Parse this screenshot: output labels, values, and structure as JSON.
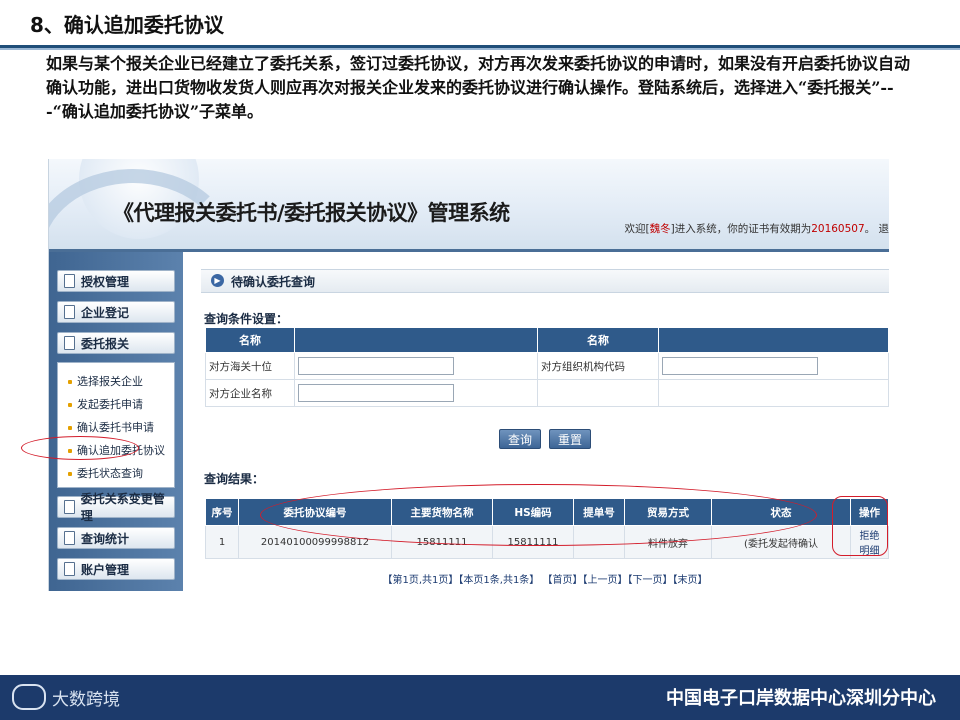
{
  "slide": {
    "title": "8、确认追加委托协议",
    "intro": "如果与某个报关企业已经建立了委托关系，签订过委托协议，对方再次发来委托协议的申请时，如果没有开启委托协议自动确认功能，进出口货物收发货人则应再次对报关企业发来的委托协议进行确认操作。登陆系统后，选择进入“委托报关”---“确认追加委托协议”子菜单。"
  },
  "app": {
    "system_title": "《代理报关委托书/委托报关协议》管理系统",
    "welcome_prefix": "欢迎[",
    "welcome_user": "魏冬",
    "welcome_mid": "]进入系统，你的证书有效期为",
    "welcome_date": "20160507",
    "welcome_suffix": "。 退"
  },
  "sidebar": {
    "items": [
      {
        "label": "授权管理"
      },
      {
        "label": "企业登记"
      },
      {
        "label": "委托报关"
      }
    ],
    "sub_items": [
      {
        "label": "选择报关企业"
      },
      {
        "label": "发起委托申请"
      },
      {
        "label": "确认委托书申请"
      },
      {
        "label": "确认追加委托协议"
      },
      {
        "label": "委托状态查询"
      }
    ],
    "lower_items": [
      {
        "label": "委托关系变更管理"
      },
      {
        "label": "查询统计"
      },
      {
        "label": "账户管理"
      }
    ]
  },
  "main": {
    "section_title": "待确认委托查询",
    "conditions_label": "查询条件设置：",
    "query_table": {
      "headers": [
        "名称",
        "",
        "名称",
        ""
      ],
      "rows": [
        {
          "label1": "对方海关十位",
          "label2": "对方组织机构代码"
        },
        {
          "label1": "对方企业名称",
          "label2": ""
        }
      ]
    },
    "buttons": {
      "query": "查询",
      "reset": "重置"
    },
    "results_label": "查询结果：",
    "results_table": {
      "headers": [
        "序号",
        "委托协议编号",
        "主要货物名称",
        "HS编码",
        "提单号",
        "贸易方式",
        "状态",
        "操作"
      ],
      "rows": [
        {
          "no": "1",
          "agreement_no": "20140100099998812",
          "goods": "15811111",
          "hs": "15811111",
          "bill": "",
          "trade": "料件放弃",
          "status": "(委托发起待确认",
          "op_reject": "拒绝",
          "op_confirm": "明细"
        }
      ]
    },
    "pager": "【第1页,共1页】【本页1条,共1条】 【首页】【上一页】【下一页】【末页】"
  },
  "footer": {
    "logo_text": "大数跨境",
    "org": "中国电子口岸数据中心深圳分中心"
  },
  "colors": {
    "header_blue": "#2f5a8a",
    "footer_blue": "#1c3a6b",
    "highlight_red": "#d31d2b"
  }
}
